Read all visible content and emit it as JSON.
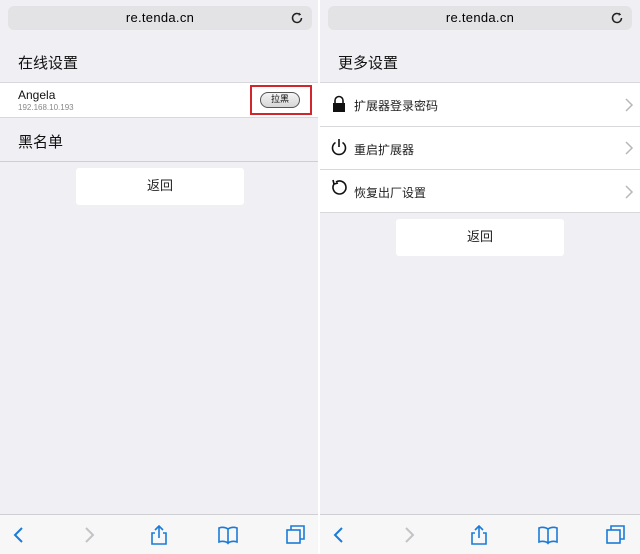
{
  "left": {
    "url": "re.tenda.cn",
    "section_title": "在线设置",
    "device": {
      "name": "Angela",
      "ip": "192.168.10.193",
      "action_label": "拉黑"
    },
    "blacklist_title": "黑名单",
    "back_label": "返回"
  },
  "right": {
    "url": "re.tenda.cn",
    "section_title": "更多设置",
    "menu": [
      {
        "label": "扩展器登录密码",
        "icon": "lock-icon"
      },
      {
        "label": "重启扩展器",
        "icon": "power-icon"
      },
      {
        "label": "恢复出厂设置",
        "icon": "reset-icon"
      }
    ],
    "back_label": "返回"
  },
  "colors": {
    "accent": "#1a7bd8",
    "highlight": "#d0262c",
    "background": "#efeff4"
  }
}
